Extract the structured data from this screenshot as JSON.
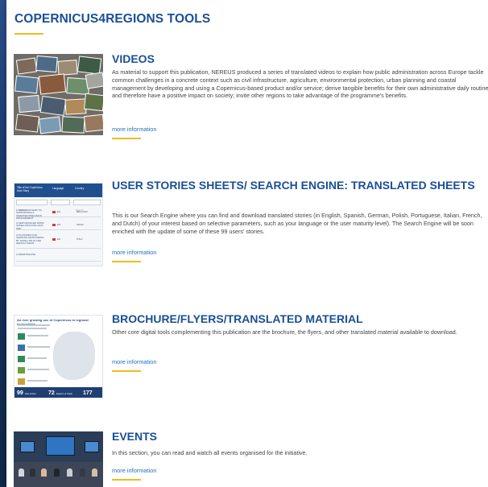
{
  "page": {
    "title": "COPERNICUS4REGIONS TOOLS"
  },
  "colors": {
    "accent": "#f3b91f",
    "heading": "#1a4f96",
    "link": "#1f6fbf",
    "background": "#1b3a6b"
  },
  "sections": [
    {
      "title": "VIDEOS",
      "body": "As material to support this publication, NEREUS produced a series of translated videos to explain how public administration across Europe tackle common challenges in a concrete context such as civil infrastructure, agriculture, environmental protection, urban planning and coastal management by developing and using a Copernicus-based product and/or service; derive tangible benefits for their own administrative daily routine and therefore have a positive impact on society; invite other regions to take advantage of the programme's benefits.",
      "link": "more information"
    },
    {
      "title": "USER STORIES SHEETS/ SEARCH ENGINE: TRANSLATED SHEETS",
      "body": "This is our Search Engine where you can find and download translated stories (in English, Spanish, German, Polish, Portuguese, Italian, French, and Dutch) of your interest based on selective parameters, such as your language or the user maturity level). The Search Engine will be soon enriched with the update of some of these 99 users' stories.",
      "link": "more information",
      "thumbnail": {
        "header": [
          "Title of the Copernicus User Story",
          "Language",
          "Country"
        ],
        "search_placeholder": "Search",
        "rows": [
          {
            "title": "A PARADIGM SHIFT IN SUPPORTING A SMARTER PRECISION MANAGEMENT",
            "lang": "EN",
            "country": "BELGIUM"
          },
          {
            "title": "A NEW DETAILED FROM SATELLITES FOR LAND MAP",
            "lang": "EN",
            "country": "SPAIN"
          },
          {
            "title": "A PLATFORM FOR SHIPPING MONITORING BY SATELLITE IN THE GENOA OCEAN",
            "lang": "EN",
            "country": "ITALY"
          },
          {
            "title": "A SMARTPHONE",
            "lang": "",
            "country": ""
          }
        ]
      }
    },
    {
      "title": "BROCHURE/FLYERS/TRANSLATED MATERIAL",
      "body": "Other core digital tools complementing this publication are the brochure, the flyers, and other translated material available to download.",
      "link": "more information",
      "thumbnail": {
        "headline": "An ever growing use of Copernicus in regional ecosystems",
        "stats": [
          {
            "value": "99",
            "label": "User stories"
          },
          {
            "value": "72",
            "label": "Regions of Origin"
          },
          {
            "value": "177",
            "label": ""
          }
        ]
      }
    },
    {
      "title": "EVENTS",
      "body": "In this section, you can read and watch all events organised for the initiative.",
      "link": "more information"
    }
  ]
}
